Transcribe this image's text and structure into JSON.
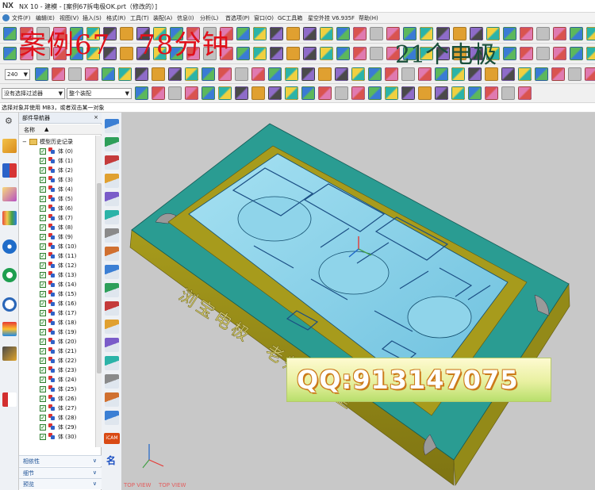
{
  "window": {
    "app_logo": "NX",
    "title": "NX 10 - 建模 - [案例67拆电极OK.prt（修改的）]"
  },
  "menu": [
    {
      "label": "文件(F)",
      "icon": "gear-icon"
    },
    {
      "label": "编辑(E)"
    },
    {
      "label": "视图(V)"
    },
    {
      "label": "插入(S)"
    },
    {
      "label": "格式(R)"
    },
    {
      "label": "工具(T)"
    },
    {
      "label": "装配(A)"
    },
    {
      "label": "信息(I)"
    },
    {
      "label": "分析(L)"
    },
    {
      "label": "首选项(P)"
    },
    {
      "label": "窗口(O)"
    },
    {
      "label": "GC工具箱"
    },
    {
      "label": "星空外挂 V6.935F"
    },
    {
      "label": "帮助(H)"
    }
  ],
  "watermark": {
    "left_caption": "案例67　78分钟",
    "right_caption": "21个电极",
    "qq": "QQ:913147075"
  },
  "toolbar": {
    "zoom_value": "240",
    "selection_filter": "没有选择过滤器",
    "assembly_scope": "整个装配"
  },
  "status": {
    "prompt": "选择对象并使用 MB3，或者双击某一对象"
  },
  "navigator": {
    "title": "部件导航器",
    "close_label": "×",
    "column_name": "名称",
    "sort_indicator": "▲",
    "root_label": "模型历史记录",
    "body_word": "体",
    "bodies": [
      "(0)",
      "(1)",
      "(2)",
      "(3)",
      "(4)",
      "(5)",
      "(6)",
      "(7)",
      "(8)",
      "(9)",
      "(10)",
      "(11)",
      "(12)",
      "(13)",
      "(14)",
      "(15)",
      "(16)",
      "(17)",
      "(18)",
      "(19)",
      "(20)",
      "(21)",
      "(22)",
      "(23)",
      "(24)",
      "(25)",
      "(26)",
      "(27)",
      "(28)",
      "(29)",
      "(30)"
    ],
    "sections": [
      "相依性",
      "细节",
      "预览"
    ]
  },
  "viewport": {
    "engraved_text": "浏宝电极　老师　作室",
    "view_labels": [
      "TOP VIEW",
      "TOP VIEW"
    ]
  },
  "colors": {
    "teal": "#2a9c92",
    "olive": "#a79b1c",
    "cavity_blue": "#8fd4ea",
    "background": "#c8c8c8"
  }
}
